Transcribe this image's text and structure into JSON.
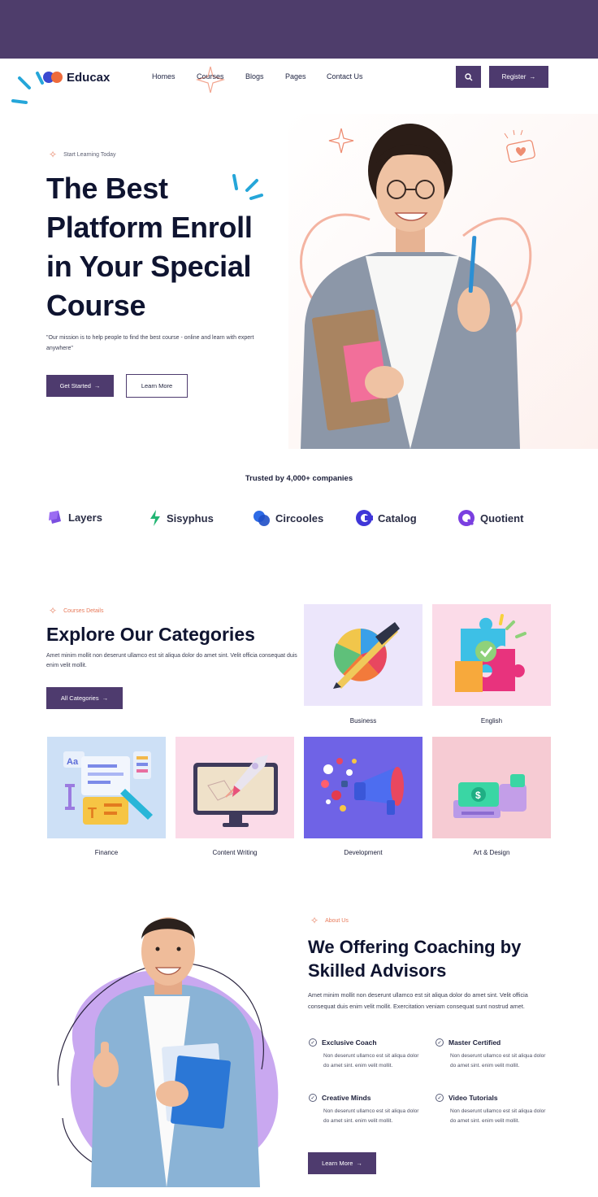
{
  "header": {
    "brand": "Educax",
    "nav": [
      "Homes",
      "Courses",
      "Blogs",
      "Pages",
      "Contact Us"
    ],
    "register_label": "Register",
    "colors": {
      "primary": "#4e3b6e",
      "accent": "#e8876a"
    }
  },
  "hero": {
    "eyebrow": "Start Learning Today",
    "title_lines": [
      "The Best",
      "Platform Enroll",
      "in Your Special",
      "Course"
    ],
    "description": "\"Our mission is to help people to find the best course - online and learn with expert anywhere\"",
    "primary_label": "Get Started",
    "secondary_label": "Learn More"
  },
  "trusted": {
    "heading": "Trusted by 4,000+ companies",
    "brands": [
      "Layers",
      "Sisyphus",
      "Circooles",
      "Catalog",
      "Quotient"
    ]
  },
  "categories": {
    "eyebrow": "Courses Details",
    "title": "Explore Our Categories",
    "description": "Amet minim mollit non deserunt ullamco est sit aliqua dolor do amet sint. Velit officia consequat duis enim velit mollit.",
    "button_label": "All Categories",
    "items": [
      "Business",
      "English",
      "Finance",
      "Content Writing",
      "Development",
      "Art & Design"
    ]
  },
  "about": {
    "eyebrow": "About Us",
    "title_lines": [
      "We Offering Coaching by",
      "Skilled Advisors"
    ],
    "description": "Amet minim mollit non deserunt ullamco est sit aliqua dolor do amet sint. Velit officia consequat duis enim velit mollit. Exercitation veniam consequat sunt nostrud amet.",
    "features": [
      {
        "title": "Exclusive Coach",
        "desc": "Non deserunt ullamco est sit aliqua dolor do amet sint. enim velit mollit."
      },
      {
        "title": "Master Certified",
        "desc": "Non deserunt ullamco est sit aliqua dolor do amet sint. enim velit mollit."
      },
      {
        "title": "Creative Minds",
        "desc": "Non deserunt ullamco est sit aliqua dolor do amet sint. enim velit mollit."
      },
      {
        "title": "Video Tutorials",
        "desc": "Non deserunt ullamco est sit aliqua dolor do amet sint. enim velit mollit."
      }
    ],
    "button_label": "Learn More"
  }
}
